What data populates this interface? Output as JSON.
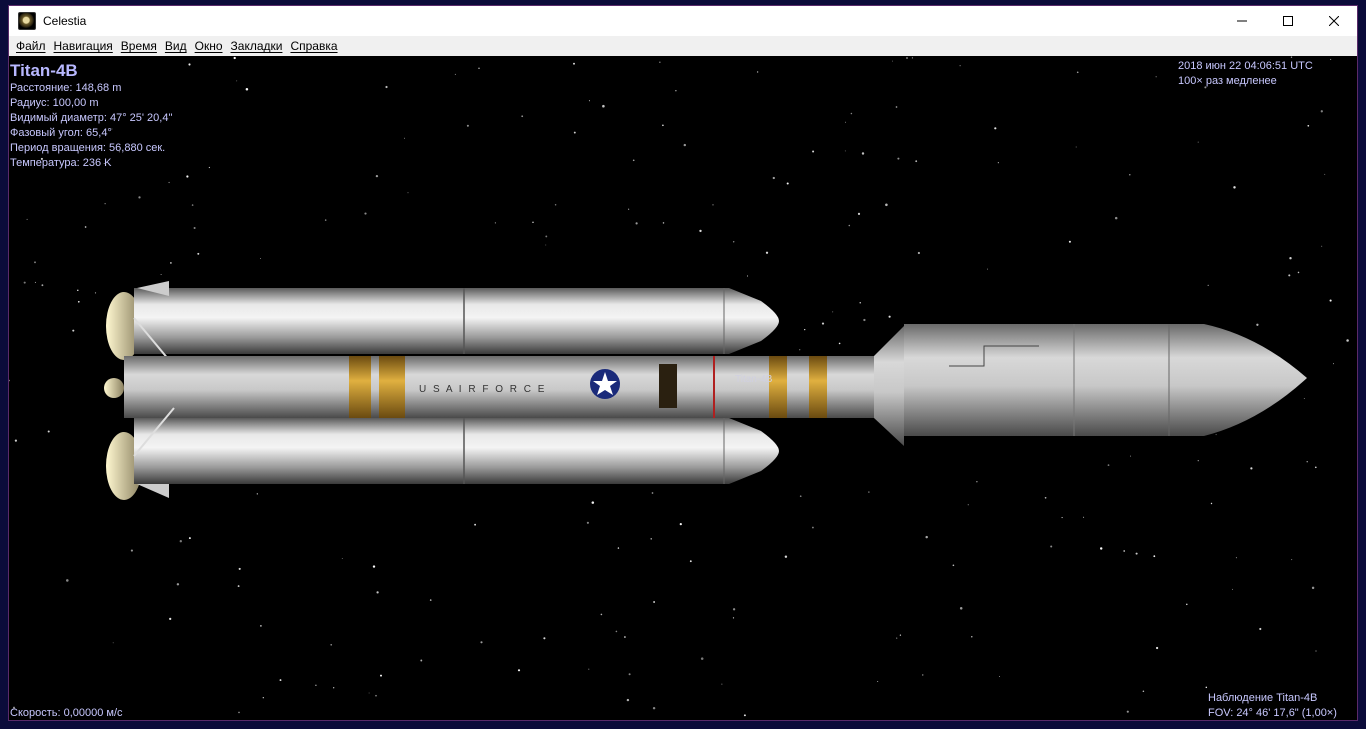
{
  "window": {
    "title": "Celestia"
  },
  "menu": [
    "Файл",
    "Навигация",
    "Время",
    "Вид",
    "Окно",
    "Закладки",
    "Справка"
  ],
  "info": {
    "object_name": "Titan-4B",
    "lines": [
      "Расстояние: 148,68 m",
      "Радиус: 100,00 m",
      "Видимый диаметр: 47° 25' 20,4\"",
      "Фазовый угол: 65,4°",
      "Период вращения: 56,880 сек.",
      "Температура: 236 K"
    ]
  },
  "time": {
    "datetime": "2018 июн 22 04:06:51 UTC",
    "rate": "100× раз медленее"
  },
  "status": {
    "speed": "Скорость: 0,00000 м/с",
    "tracking": "Наблюдение Titan-4B",
    "fov": "FOV: 24° 46' 17,6\" (1,00×)"
  },
  "rocket": {
    "label": "Titan-4B",
    "band_text": "U S A I R F O R C E"
  }
}
